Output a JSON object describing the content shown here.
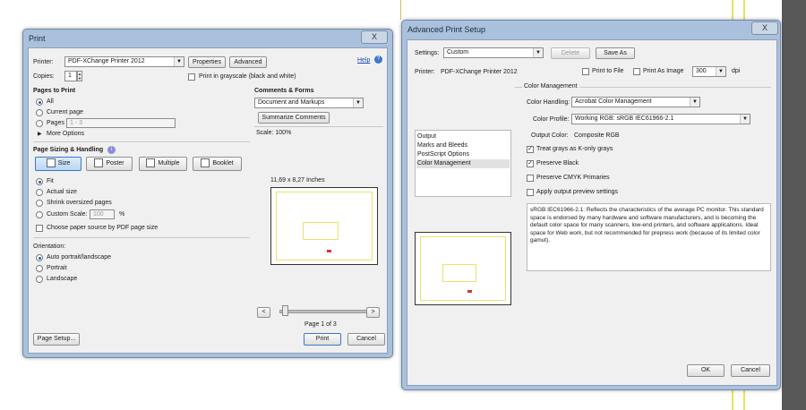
{
  "colors": {
    "accent": "#2a5aa8",
    "preview_lines": "#e9e26b",
    "desktop_dark": "#555555"
  },
  "print_dialog": {
    "title": "Print",
    "close_glyph": "X",
    "printer_label": "Printer:",
    "printer_value": "PDF-XChange Printer 2012",
    "properties_label": "Properties",
    "advanced_label": "Advanced",
    "help_label": "Help",
    "copies_label": "Copies:",
    "copies_value": "1",
    "grayscale_label": "Print in grayscale (black and white)",
    "pages_heading": "Pages to Print",
    "all_label": "All",
    "current_page_label": "Current page",
    "pages_label": "Pages",
    "pages_value": "1 - 3",
    "more_options_label": "More Options",
    "sizing_heading": "Page Sizing & Handling",
    "size_tab": "Size",
    "poster_tab": "Poster",
    "multiple_tab": "Multiple",
    "booklet_tab": "Booklet",
    "fit_label": "Fit",
    "actual_size_label": "Actual size",
    "shrink_label": "Shrink oversized pages",
    "custom_scale_label": "Custom Scale:",
    "custom_scale_value": "100",
    "percent": "%",
    "paper_source_label": "Choose paper source by PDF page size",
    "orientation_heading": "Orientation:",
    "auto_orient_label": "Auto portrait/landscape",
    "portrait_label": "Portrait",
    "landscape_label": "Landscape",
    "comments_heading": "Comments & Forms",
    "comments_value": "Document and Markups",
    "summarize_label": "Summarize Comments",
    "scale_text": "Scale: 100%",
    "dimensions_text": "11,69 x 8,27 Inches",
    "prev_glyph": "<",
    "next_glyph": ">",
    "page_counter": "Page 1 of 3",
    "page_setup_label": "Page Setup...",
    "print_label": "Print",
    "cancel_label": "Cancel"
  },
  "advanced_dialog": {
    "title": "Advanced Print Setup",
    "close_glyph": "X",
    "settings_label": "Settings:",
    "settings_value": "Custom",
    "delete_label": "Delete",
    "save_as_label": "Save As",
    "printer_label": "Printer:",
    "printer_value": "PDF-XChange Printer 2012",
    "print_to_file_label": "Print to File",
    "print_as_image_label": "Print As Image",
    "dpi_value": "300",
    "dpi_label": "dpi",
    "categories": [
      "Output",
      "Marks and Bleeds",
      "PostScript Options",
      "Color Management"
    ],
    "section_title": "Color Management",
    "color_handling_label": "Color Handling:",
    "color_handling_value": "Acrobat Color Management",
    "color_profile_label": "Color Profile:",
    "color_profile_value": "Working RGB: sRGB IEC61966-2.1",
    "output_color_label": "Output Color:",
    "output_color_value": "Composite RGB",
    "treat_grays_label": "Treat grays as K-only grays",
    "preserve_black_label": "Preserve Black",
    "preserve_cmyk_label": "Preserve CMYK Primaries",
    "apply_preview_label": "Apply output preview settings",
    "description": "sRGB IEC61966-2.1:  Reflects the characteristics of the average PC monitor.  This standard space is endorsed by many hardware and software manufacturers, and is becoming the default color space for many scanners, low-end printers, and software applications. Ideal space for Web work, but not recommended for prepress work (because of its limited color gamut).",
    "ok_label": "OK",
    "cancel_label": "Cancel"
  }
}
